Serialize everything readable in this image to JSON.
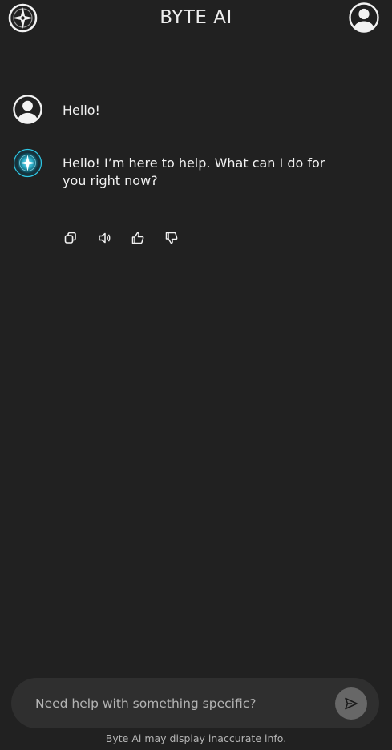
{
  "header": {
    "title": "BYTE AI",
    "menu_icon": "compass-icon",
    "profile_icon": "user-avatar-icon"
  },
  "messages": [
    {
      "role": "user",
      "avatar_icon": "user-avatar-icon",
      "text": "Hello!"
    },
    {
      "role": "assistant",
      "avatar_icon": "byte-ai-logo",
      "text": "Hello! I’m here to help. What can I do for you right now?"
    }
  ],
  "message_actions": [
    {
      "name": "copy",
      "icon": "copy-icon"
    },
    {
      "name": "read-aloud",
      "icon": "speaker-icon"
    },
    {
      "name": "good-response",
      "icon": "thumbs-up-icon"
    },
    {
      "name": "bad-response",
      "icon": "thumbs-down-icon"
    }
  ],
  "composer": {
    "placeholder": "Need help with something specific?",
    "value": "",
    "send_icon": "send-icon"
  },
  "footer": {
    "disclaimer": "Byte Ai may display inaccurate info."
  },
  "colors": {
    "background": "#212121",
    "composer": "#2f2f2f",
    "send_button": "#676767",
    "logo_accent": "#2ec8e6"
  }
}
